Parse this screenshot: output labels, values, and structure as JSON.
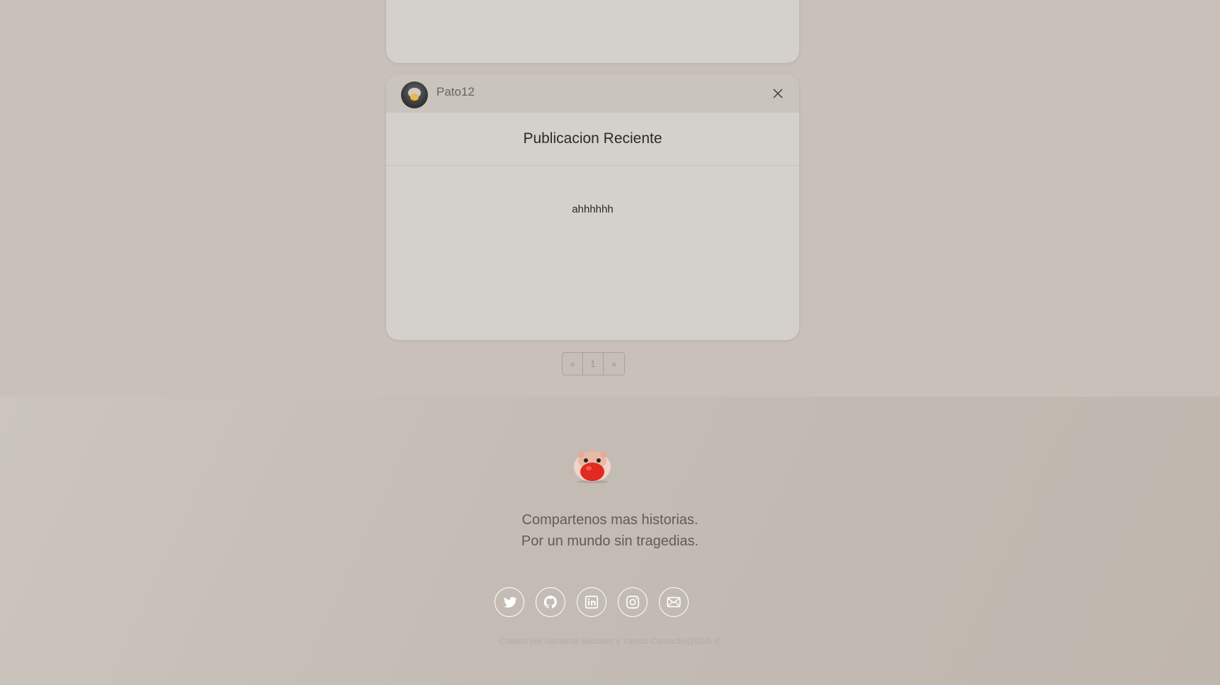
{
  "post": {
    "username": "Pato12",
    "title": "Publicacion Reciente",
    "body": "ahhhhhh"
  },
  "pagination": {
    "prev_label": "«",
    "current_page": "1",
    "next_label": "»"
  },
  "footer": {
    "tagline_line1": "Compartenos mas historias.",
    "tagline_line2": "Por un mundo sin tragedias.",
    "credit": "Creado por Samanta Sanchez y Yaretzi Camacho(2024) ©",
    "social_icons": [
      "twitter-icon",
      "github-icon",
      "linkedin-icon",
      "instagram-icon",
      "mail-icon"
    ]
  },
  "colors": {
    "background": "#c9c1b9",
    "card": "#d4d1cc",
    "card_header": "#c9c4be",
    "text_primary": "#2c2a28",
    "text_muted": "#625c57",
    "icon_stroke": "#ffffff"
  }
}
